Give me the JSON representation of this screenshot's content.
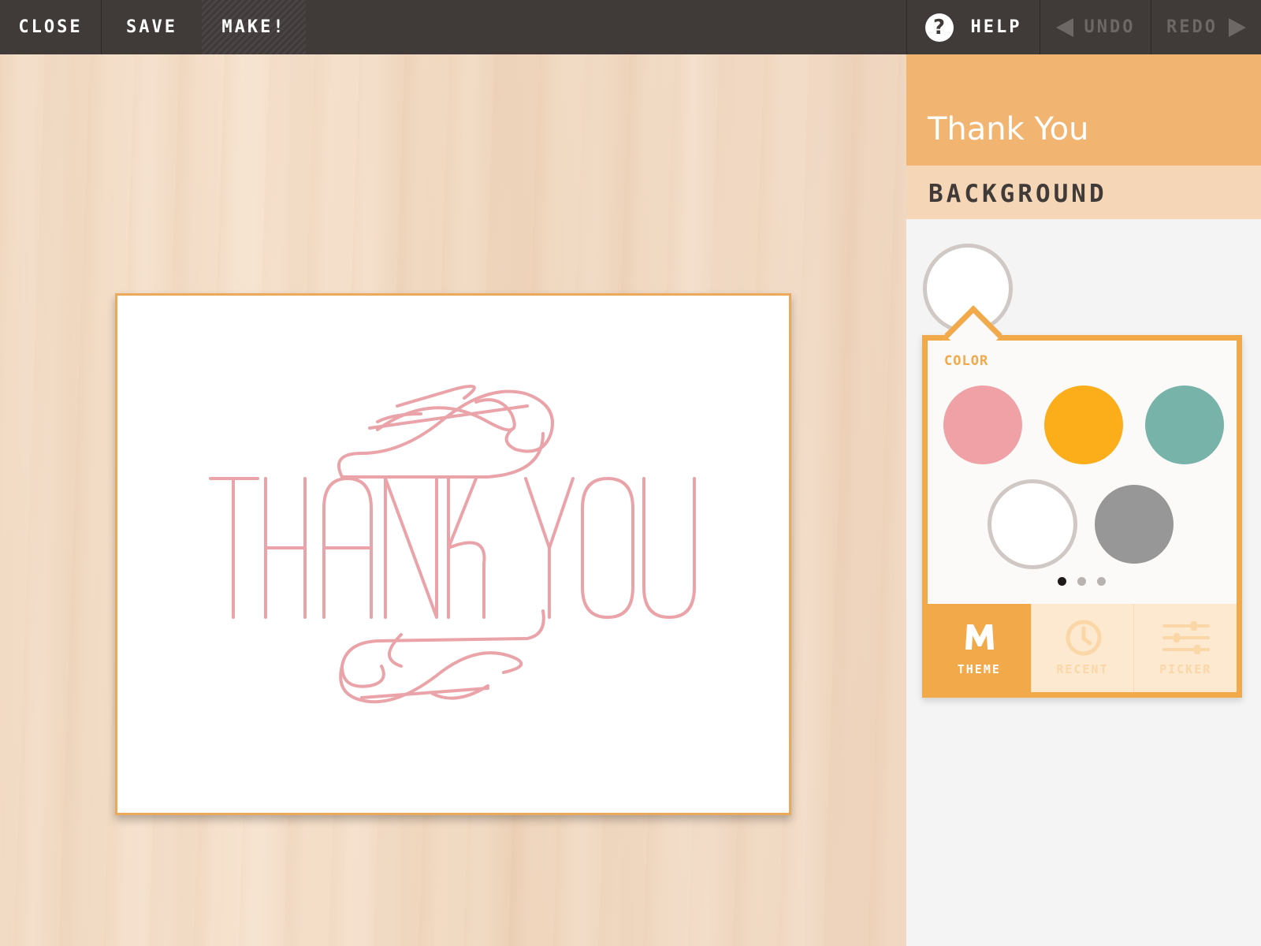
{
  "toolbar": {
    "close_label": "CLOSE",
    "save_label": "SAVE",
    "make_label": "MAKE!",
    "help_label": "HELP",
    "help_glyph": "?",
    "undo_label": "UNDO",
    "redo_label": "REDO"
  },
  "card": {
    "text": "THANK YOU",
    "text_color": "#eaa3a8"
  },
  "panel": {
    "title": "Thank You",
    "section": "BACKGROUND",
    "current_color": "#ffffff",
    "color_label": "COLOR",
    "swatches": [
      "#f0a1a6",
      "#fbae1a",
      "#77b3a9",
      "#ffffff",
      "#979797"
    ],
    "page_dots": 3,
    "active_dot": 0,
    "tabs": [
      {
        "label": "THEME",
        "icon": "m-logo-icon",
        "active": true
      },
      {
        "label": "RECENT",
        "icon": "clock-icon",
        "active": false
      },
      {
        "label": "PICKER",
        "icon": "sliders-icon",
        "active": false
      }
    ]
  },
  "colors": {
    "toolbar_bg": "#403b39",
    "accent": "#f2a94a",
    "header": "#f2b571"
  }
}
